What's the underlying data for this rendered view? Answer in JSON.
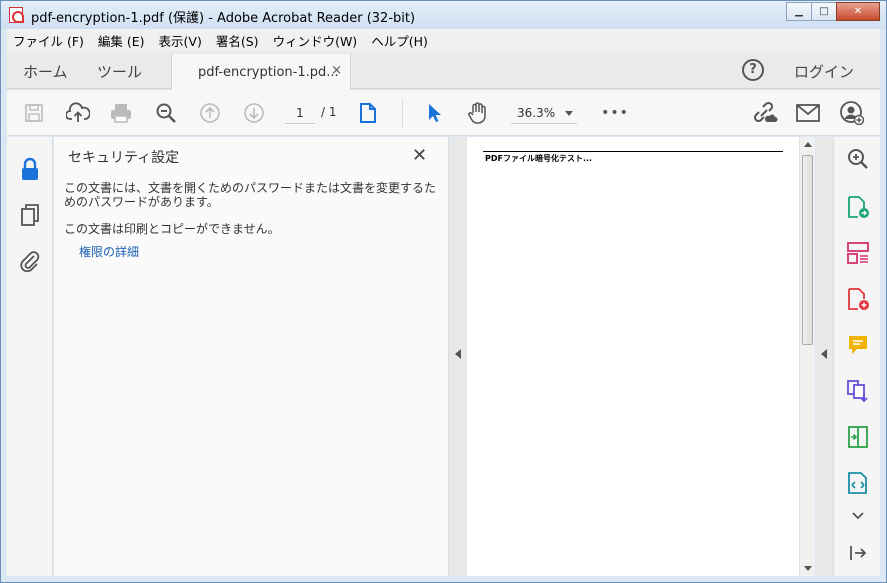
{
  "window": {
    "title": "pdf-encryption-1.pdf (保護) - Adobe Acrobat Reader (32-bit)",
    "minimize": "▁",
    "maximize": "□",
    "close": "✕"
  },
  "menubar": {
    "items": [
      "ファイル (F)",
      "編集 (E)",
      "表示(V)",
      "署名(S)",
      "ウィンドウ(W)",
      "ヘルプ(H)"
    ]
  },
  "tabs": {
    "home": "ホーム",
    "tools": "ツール",
    "document": "pdf-encryption-1.pd...",
    "close": "×",
    "help": "?",
    "login": "ログイン"
  },
  "toolbar": {
    "page_current": "1",
    "page_total": "/ 1",
    "zoom": "36.3%",
    "more": "•••"
  },
  "panel": {
    "title": "セキュリティ設定",
    "close": "✕",
    "text1": "この文書には、文書を開くためのパスワードまたは文書を変更するためのパスワードがあります。",
    "text2": "この文書は印刷とコピーができません。",
    "link": "権限の詳細"
  },
  "document": {
    "heading": "PDFファイル暗号化テスト..."
  },
  "colors": {
    "accent": "#1a73d9",
    "link": "#1a5fb4"
  }
}
